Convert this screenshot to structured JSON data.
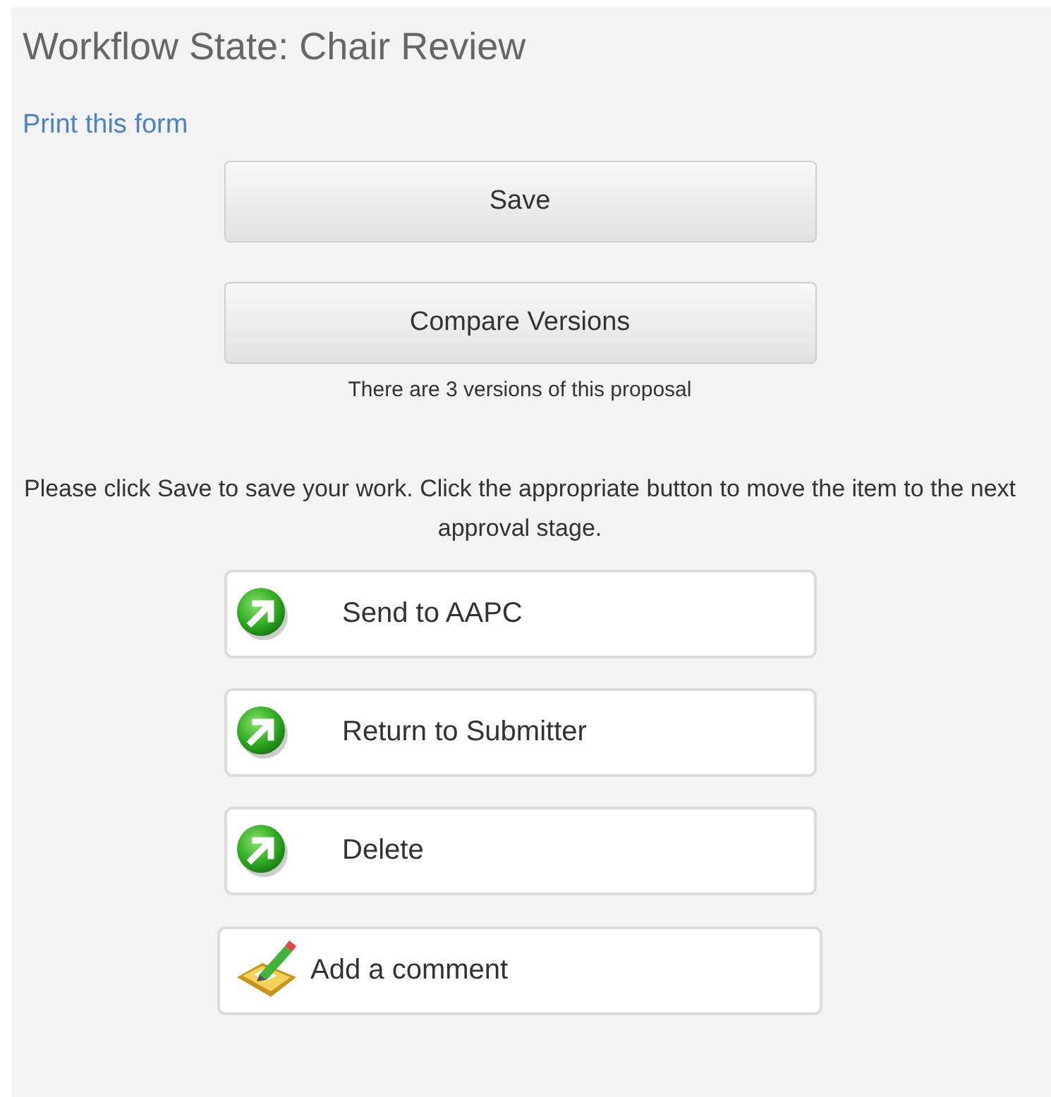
{
  "title": "Workflow State: Chair Review",
  "print_link": "Print this form",
  "buttons": [
    {
      "label": "Save"
    },
    {
      "label": "Compare Versions"
    }
  ],
  "versions_note": "There are 3 versions of this proposal",
  "instructions": "Please click Save to save your work. Click the appropriate button to move the item to the next approval stage.",
  "actions": [
    {
      "label": "Send to AAPC",
      "kind": "transition"
    },
    {
      "label": "Return to Submitter",
      "kind": "transition"
    },
    {
      "label": "Delete",
      "kind": "transition"
    },
    {
      "label": "Add a comment",
      "kind": "comment"
    }
  ]
}
